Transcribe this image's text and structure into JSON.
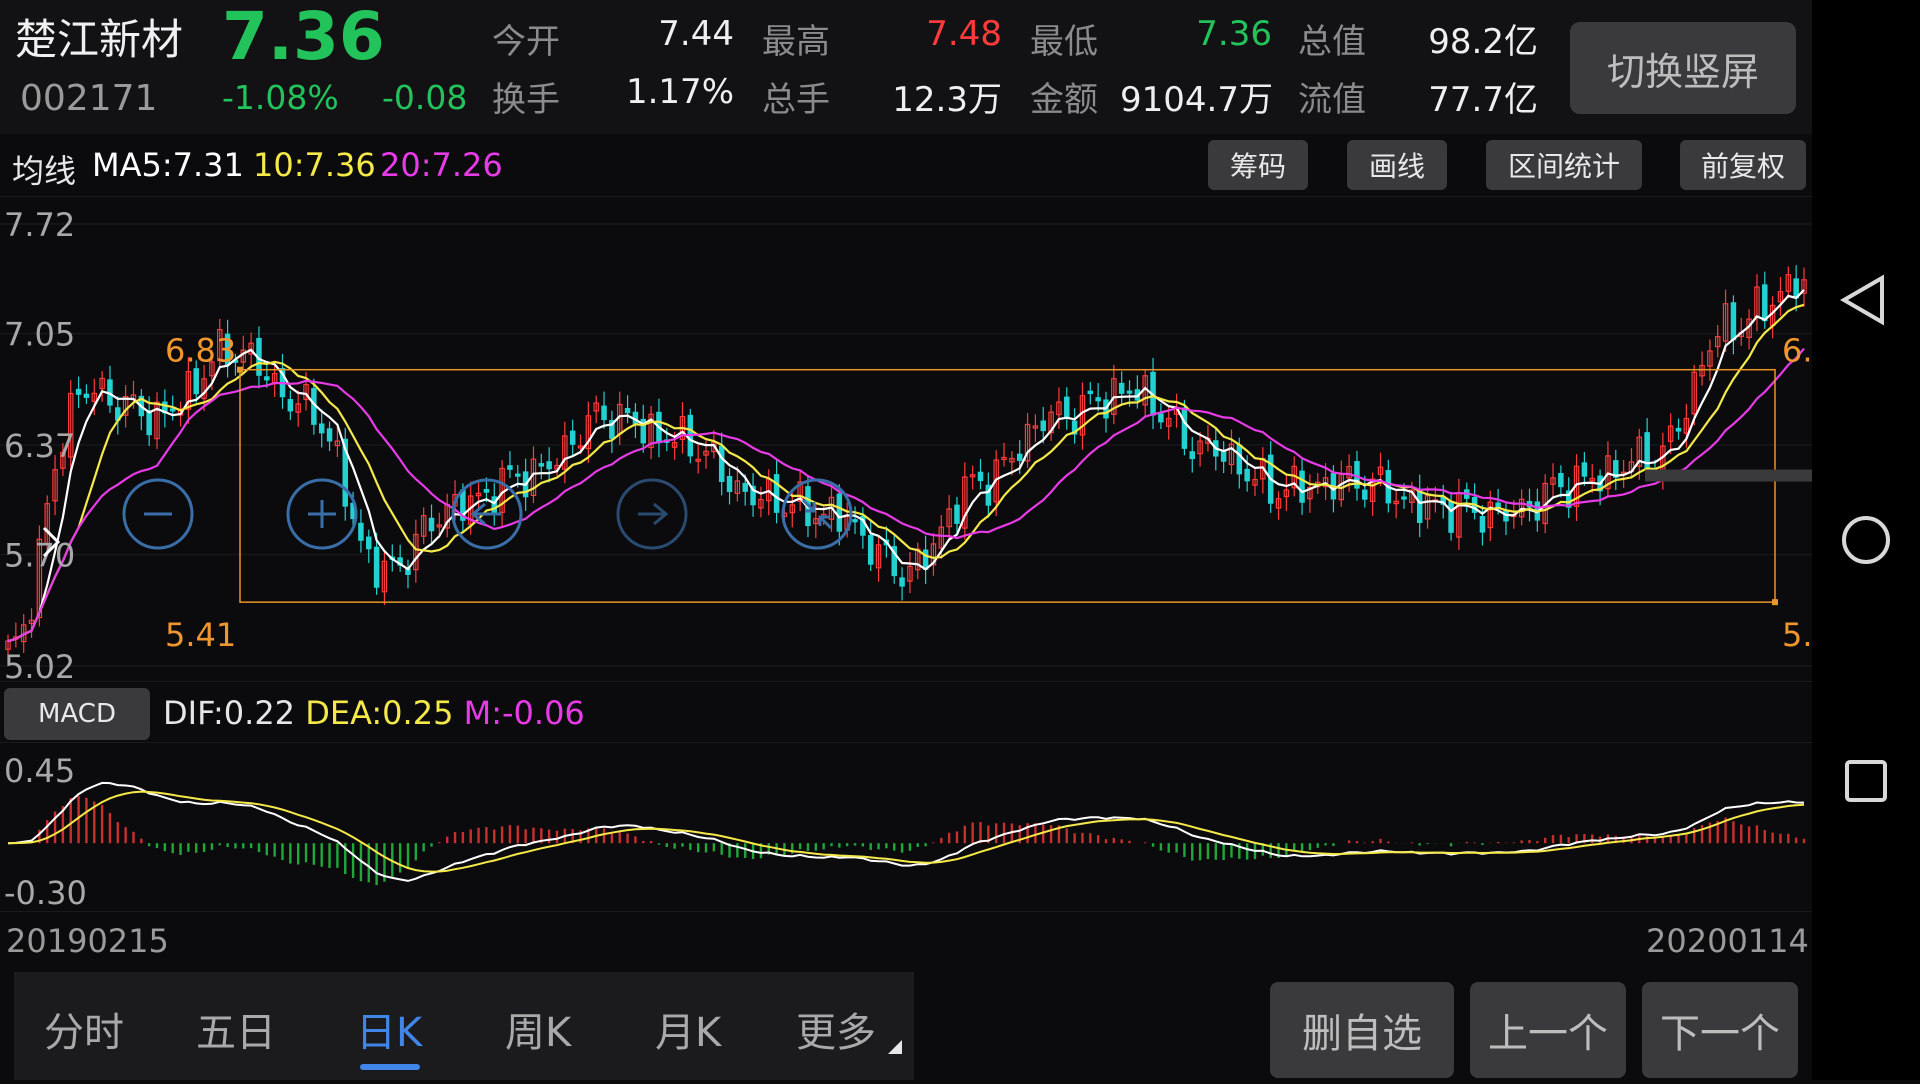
{
  "header": {
    "stock_name": "楚江新材",
    "stock_code": "002171",
    "price": "7.36",
    "change_pct": "-1.08%",
    "change": "-0.08",
    "quotes": [
      {
        "label": "今开",
        "value": "7.44",
        "color": "#efefef"
      },
      {
        "label": "最高",
        "value": "7.48",
        "color": "#ff3b3b"
      },
      {
        "label": "最低",
        "value": "7.36",
        "color": "#22c35a"
      },
      {
        "label": "总值",
        "value": "98.2亿",
        "color": "#efefef"
      },
      {
        "label": "换手",
        "value": "1.17%",
        "color": "#efefef"
      },
      {
        "label": "总手",
        "value": "12.3万",
        "color": "#efefef"
      },
      {
        "label": "金额",
        "value": "9104.7万",
        "color": "#efefef"
      },
      {
        "label": "流值",
        "value": "77.7亿",
        "color": "#efefef"
      }
    ],
    "switch_button": "切换竖屏"
  },
  "ma_bar": {
    "label": "均线",
    "ma5": "MA5:7.31",
    "ma10": "10:7.36",
    "ma20": "20:7.26",
    "colors": {
      "ma5": "#ffffff",
      "ma10": "#f5e94a",
      "ma20": "#e83be8"
    }
  },
  "toolbar": {
    "chips": "筹码",
    "draw": "画线",
    "range_stats": "区间统计",
    "adjust": "前复权"
  },
  "kline": {
    "y_ticks": [
      "7.72",
      "7.05",
      "6.37",
      "5.70",
      "5.02"
    ],
    "range_high_label": "6.83",
    "range_low_label": "5.41",
    "range_high_right": "6.",
    "range_low_right": "5.",
    "controls": [
      "zoom-out-icon",
      "zoom-in-icon",
      "arrow-left-icon",
      "arrow-right-icon",
      "compress-icon"
    ]
  },
  "macd": {
    "button": "MACD",
    "dif": "DIF:0.22",
    "dea": "DEA:0.25",
    "m": "M:-0.06",
    "y_ticks": [
      "0.45",
      "-0.30"
    ]
  },
  "dates": {
    "start": "20190215",
    "end": "20200114"
  },
  "periods": [
    "分时",
    "五日",
    "日K",
    "周K",
    "月K",
    "更多"
  ],
  "active_period": "日K",
  "actions": {
    "remove_watch": "删自选",
    "prev": "上一个",
    "next": "下一个"
  },
  "nav_icons": [
    "back-triangle-icon",
    "home-circle-icon",
    "recents-square-icon"
  ],
  "chart_data": {
    "type": "line",
    "title": "",
    "x_range": [
      "20190215",
      "20200114"
    ],
    "ylim": [
      5.02,
      7.72
    ],
    "y_ticks": [
      7.72,
      7.05,
      6.37,
      5.7,
      5.02
    ],
    "price_anchor_points": [
      [
        "20190215",
        5.1
      ],
      [
        "20190301",
        6.7
      ],
      [
        "20190315",
        6.55
      ],
      [
        "20190329",
        6.95
      ],
      [
        "20190412",
        6.6
      ],
      [
        "20190426",
        5.6
      ],
      [
        "20190510",
        6.0
      ],
      [
        "20190524",
        6.2
      ],
      [
        "20190607",
        6.55
      ],
      [
        "20190621",
        6.4
      ],
      [
        "20190705",
        6.05
      ],
      [
        "20190719",
        5.95
      ],
      [
        "20190802",
        5.6
      ],
      [
        "20190816",
        6.15
      ],
      [
        "20190830",
        6.55
      ],
      [
        "20190913",
        6.7
      ],
      [
        "20190927",
        6.35
      ],
      [
        "20191011",
        6.1
      ],
      [
        "20191025",
        6.15
      ],
      [
        "20191108",
        6.0
      ],
      [
        "20191122",
        5.95
      ],
      [
        "20191206",
        6.15
      ],
      [
        "20191220",
        6.3
      ],
      [
        "20200103",
        7.1
      ],
      [
        "20200114",
        7.36
      ]
    ],
    "range_box": {
      "high": 6.83,
      "low": 5.41
    },
    "macd_ylim": [
      -0.3,
      0.45
    ]
  }
}
